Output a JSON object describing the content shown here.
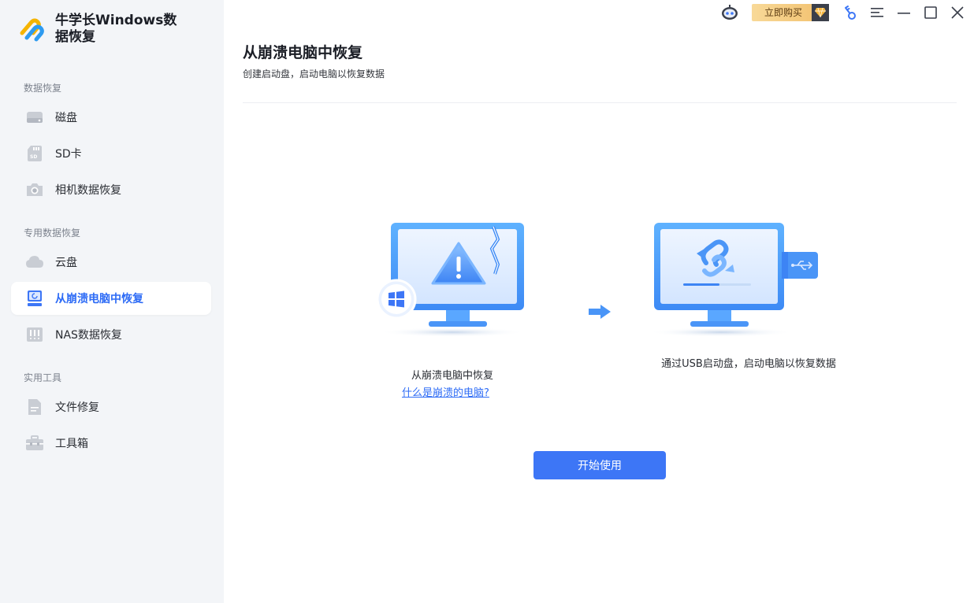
{
  "app": {
    "title": "牛学长Windows数据恢复"
  },
  "sidebar": {
    "sections": [
      {
        "title": "数据恢复",
        "items": [
          {
            "label": "磁盘",
            "icon": "disk-icon"
          },
          {
            "label": "SD卡",
            "icon": "sd-card-icon"
          },
          {
            "label": "相机数据恢复",
            "icon": "camera-icon"
          }
        ]
      },
      {
        "title": "专用数据恢复",
        "items": [
          {
            "label": "云盘",
            "icon": "cloud-icon"
          },
          {
            "label": "从崩溃电脑中恢复",
            "icon": "crashed-computer-icon",
            "active": true
          },
          {
            "label": "NAS数据恢复",
            "icon": "nas-icon"
          }
        ]
      },
      {
        "title": "实用工具",
        "items": [
          {
            "label": "文件修复",
            "icon": "file-repair-icon"
          },
          {
            "label": "工具箱",
            "icon": "toolbox-icon"
          }
        ]
      }
    ]
  },
  "titlebar": {
    "buy_label": "立即购买",
    "icons": [
      "robot-icon",
      "gem-icon",
      "key-icon",
      "menu-icon",
      "minimize-icon",
      "maximize-icon",
      "close-icon"
    ]
  },
  "main": {
    "title": "从崩溃电脑中恢复",
    "subtitle": "创建启动盘，启动电脑以恢复数据",
    "step1_caption": "从崩溃电脑中恢复",
    "step1_link": "什么是崩溃的电脑?",
    "step2_caption": "通过USB启动盘，启动电脑以恢复数据",
    "start_button": "开始使用"
  },
  "colors": {
    "accent": "#3d76f6",
    "sidebar_bg": "#f3f5f8",
    "buy_gold": "#f3c576"
  }
}
